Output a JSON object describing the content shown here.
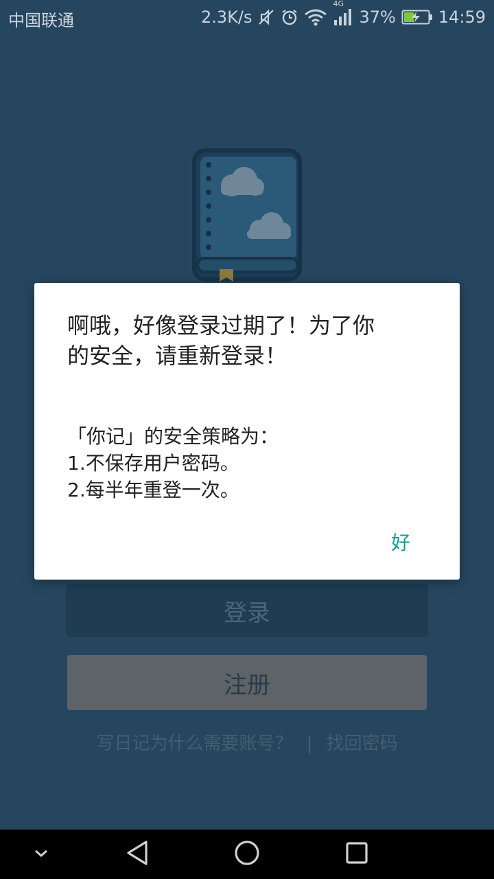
{
  "status_bar": {
    "carrier": "中国联通",
    "net_speed": "2.3K/s",
    "network_type": "4G",
    "battery_percent": "37%",
    "time": "14:59",
    "icons": [
      "mute-icon",
      "alarm-icon",
      "wifi-icon",
      "signal-icon",
      "battery-charging-icon"
    ]
  },
  "app": {
    "login_label": "登录",
    "register_label": "注册",
    "why_account_link": "写日记为什么需要账号？",
    "separator": "|",
    "recover_password_link": "找回密码"
  },
  "dialog": {
    "title_lines": [
      "啊哦，好像登录过期了！为了你",
      "的安全，请重新登录！"
    ],
    "message_lines": [
      "「你记」的安全策略为：",
      "1.不保存用户密码。",
      "2.每半年重登一次。"
    ],
    "ok_label": "好"
  },
  "colors": {
    "background": "#26465f",
    "accent": "#139c94"
  }
}
